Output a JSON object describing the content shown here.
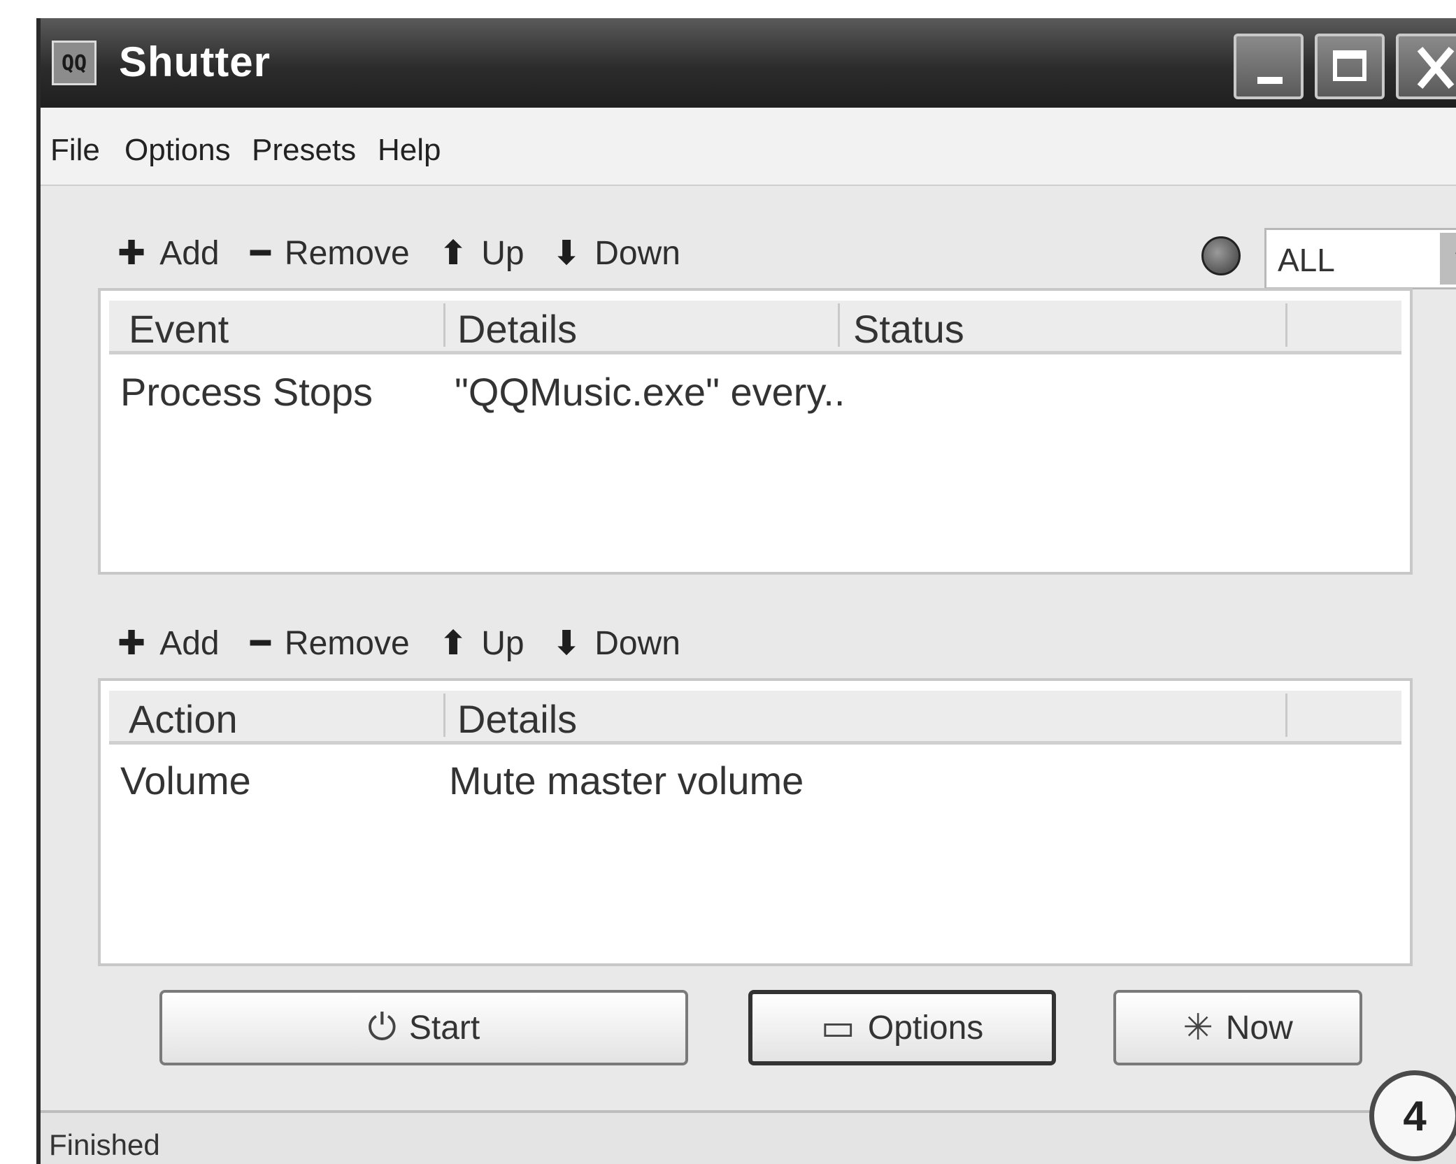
{
  "window": {
    "title": "Shutter",
    "app_icon_glyph": "QQ"
  },
  "menu": {
    "items": [
      {
        "label": "File"
      },
      {
        "label": "Options"
      },
      {
        "label": "Presets"
      },
      {
        "label": "Help"
      }
    ]
  },
  "events": {
    "toolbar": {
      "add": "Add",
      "remove": "Remove",
      "up": "Up",
      "down": "Down"
    },
    "filter": {
      "icon": "globe-icon",
      "selected": "ALL"
    },
    "columns": [
      "Event",
      "Details",
      "Status"
    ],
    "rows": [
      {
        "event": "Process Stops",
        "details": "\"QQMusic.exe\" every..",
        "status": ""
      }
    ]
  },
  "actions": {
    "toolbar": {
      "add": "Add",
      "remove": "Remove",
      "up": "Up",
      "down": "Down"
    },
    "columns": [
      "Action",
      "Details"
    ],
    "rows": [
      {
        "action": "Volume",
        "details": "Mute master volume"
      }
    ]
  },
  "buttons": {
    "start": "Start",
    "options": "Options",
    "now": "Now"
  },
  "status": {
    "text": "Finished"
  },
  "badge": {
    "number": "4"
  }
}
